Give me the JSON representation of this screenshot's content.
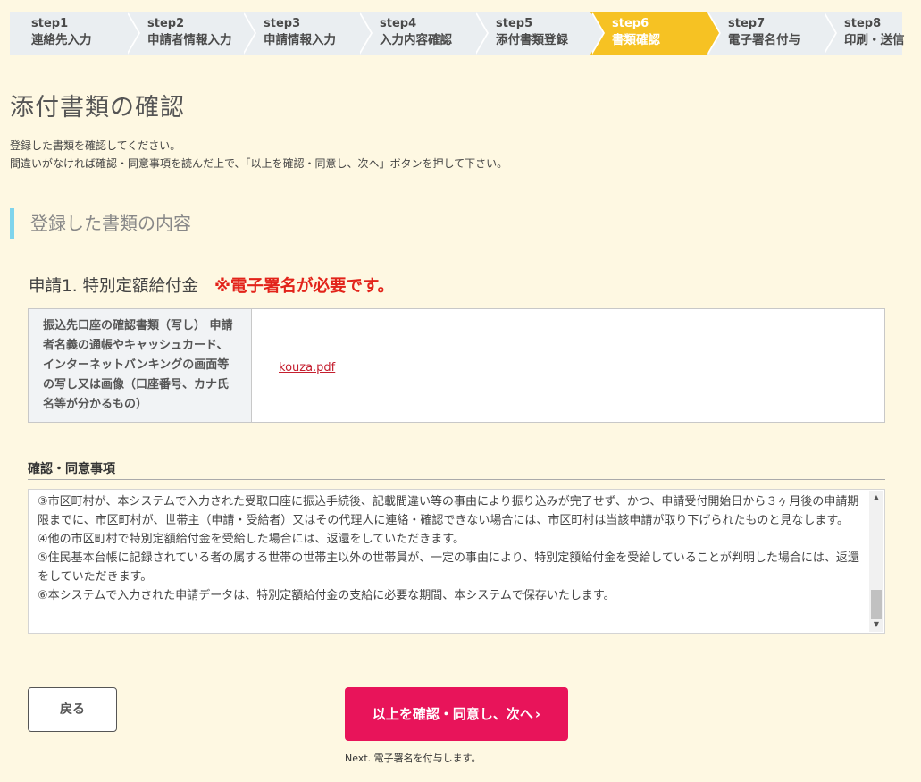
{
  "steps": [
    {
      "num": "step1",
      "name": "連絡先入力",
      "active": false
    },
    {
      "num": "step2",
      "name": "申請者情報入力",
      "active": false
    },
    {
      "num": "step3",
      "name": "申請情報入力",
      "active": false
    },
    {
      "num": "step4",
      "name": "入力内容確認",
      "active": false
    },
    {
      "num": "step5",
      "name": "添付書類登録",
      "active": false
    },
    {
      "num": "step6",
      "name": "書類確認",
      "active": true
    },
    {
      "num": "step7",
      "name": "電子署名付与",
      "active": false
    },
    {
      "num": "step8",
      "name": "印刷・送信",
      "active": false
    }
  ],
  "page": {
    "title": "添付書類の確認",
    "intro_line1": "登録した書類を確認してください。",
    "intro_line2": "間違いがなければ確認・同意事項を読んだ上で、「以上を確認・同意し、次へ」ボタンを押して下さい。"
  },
  "section": {
    "heading": "登録した書類の内容"
  },
  "application": {
    "title": "申請1. 特別定額給付金",
    "warning": "※電子署名が必要です。"
  },
  "documents": [
    {
      "label": "振込先口座の確認書類（写し） 申請者名義の通帳やキャッシュカード、インターネットバンキングの画面等の写し又は画像（口座番号、カナ氏名等が分かるもの）",
      "file": "kouza.pdf"
    }
  ],
  "consent": {
    "heading": "確認・同意事項",
    "lines": [
      "③市区町村が、本システムで入力された受取口座に振込手続後、記載間違い等の事由により振り込みが完了せず、かつ、申請受付開始日から３ヶ月後の申請期限までに、市区町村が、世帯主（申請・受給者）又はその代理人に連絡・確認できない場合には、市区町村は当該申請が取り下げられたものと見なします。",
      "④他の市区町村で特別定額給付金を受給した場合には、返還をしていただきます。",
      "⑤住民基本台帳に記録されている者の属する世帯の世帯主以外の世帯員が、一定の事由により、特別定額給付金を受給していることが判明した場合には、返還をしていただきます。",
      "⑥本システムで入力された申請データは、特別定額給付金の支給に必要な期間、本システムで保存いたします。"
    ]
  },
  "buttons": {
    "back": "戻る",
    "next": "以上を確認・同意し、次へ",
    "next_chevron": "›",
    "next_note": "Next. 電子署名を付与します。"
  },
  "icons": {
    "scroll_up": "▲",
    "scroll_down": "▼"
  },
  "colors": {
    "background": "#fef8e2",
    "active_step": "#f6c223",
    "warning": "#e2231a",
    "primary_button": "#e8145a",
    "section_accent": "#7fd4ec"
  }
}
